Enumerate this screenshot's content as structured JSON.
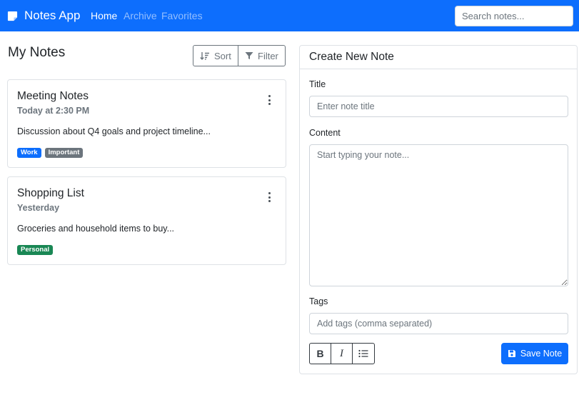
{
  "navbar": {
    "brand": "Notes App",
    "brand_icon": "sticky-note-icon",
    "links": [
      {
        "label": "Home",
        "active": true
      },
      {
        "label": "Archive",
        "active": false
      },
      {
        "label": "Favorites",
        "active": false
      }
    ],
    "search_placeholder": "Search notes..."
  },
  "notes_panel": {
    "title": "My Notes",
    "sort_label": "Sort",
    "filter_label": "Filter",
    "notes": [
      {
        "title": "Meeting Notes",
        "time": "Today at 2:30 PM",
        "description": "Discussion about Q4 goals and project timeline...",
        "tags": [
          {
            "label": "Work",
            "color": "#0d6efd"
          },
          {
            "label": "Important",
            "color": "#6c757d"
          }
        ]
      },
      {
        "title": "Shopping List",
        "time": "Yesterday",
        "description": "Groceries and household items to buy...",
        "tags": [
          {
            "label": "Personal",
            "color": "#198754"
          }
        ]
      }
    ]
  },
  "create_form": {
    "header": "Create New Note",
    "title_label": "Title",
    "title_placeholder": "Enter note title",
    "content_label": "Content",
    "content_placeholder": "Start typing your note...",
    "tags_label": "Tags",
    "tags_placeholder": "Add tags (comma separated)",
    "format_buttons": [
      "bold-icon",
      "italic-icon",
      "list-icon"
    ],
    "save_label": "Save Note"
  },
  "colors": {
    "primary": "#0d6efd",
    "secondary": "#6c757d",
    "success": "#198754"
  }
}
